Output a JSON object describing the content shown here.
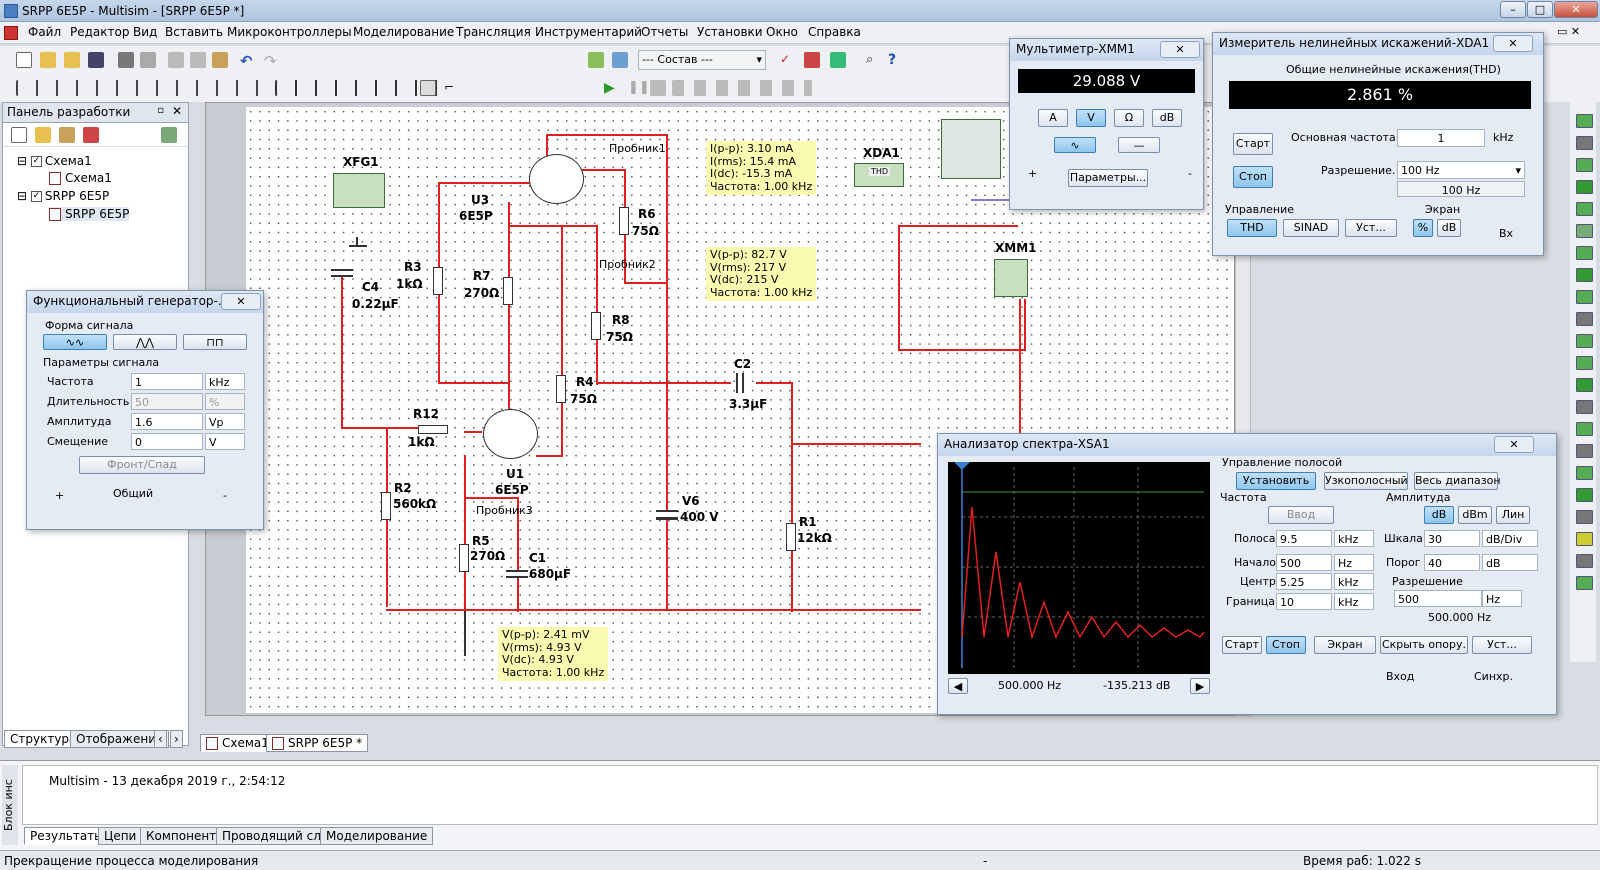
{
  "app": {
    "title": "SRPP  6E5P - Multisim - [SRPP  6E5P *]"
  },
  "menu": [
    "Файл",
    "Редактор",
    "Вид",
    "Вставить",
    "Микроконтроллеры",
    "Моделирование",
    "Трансляция",
    "Инструментарий",
    "Отчеты",
    "Установки",
    "Окно",
    "Справка"
  ],
  "toolbar": {
    "parts_combo": "--- Состав ---"
  },
  "panel": {
    "title": "Панель разработки",
    "tree": [
      "Схема1",
      "Схема1",
      "SRPP  6E5P",
      "SRPP  6E5P"
    ],
    "tabs": [
      "Структура",
      "Отображение"
    ]
  },
  "doc_tabs": [
    "Схема1",
    "SRPP  6E5P *"
  ],
  "schematic": {
    "components": [
      {
        "ref": "XFG1"
      },
      {
        "ref": "C4",
        "value": "0.22µF"
      },
      {
        "ref": "R3",
        "value": "1kΩ"
      },
      {
        "ref": "U3",
        "value": "6E5P"
      },
      {
        "ref": "R7",
        "value": "270Ω"
      },
      {
        "ref": "R6",
        "value": "75Ω"
      },
      {
        "ref": "R8",
        "value": "75Ω"
      },
      {
        "ref": "R4",
        "value": "75Ω"
      },
      {
        "ref": "R12",
        "value": "1kΩ"
      },
      {
        "ref": "U1",
        "value": "6E5P"
      },
      {
        "ref": "R2",
        "value": "560kΩ"
      },
      {
        "ref": "R5",
        "value": "270Ω"
      },
      {
        "ref": "C1",
        "value": "680µF"
      },
      {
        "ref": "V6",
        "value": "400 V"
      },
      {
        "ref": "C2",
        "value": "3.3µF"
      },
      {
        "ref": "R1",
        "value": "12kΩ"
      },
      {
        "ref": "XDA1"
      },
      {
        "ref": "XMM1"
      }
    ],
    "probes": [
      {
        "name": "Пробник1",
        "text": "I(p-p): 3.10 mA\nI(rms): 15.4 mA\nI(dc): -15.3 mA\nЧастота: 1.00 kHz"
      },
      {
        "name": "Пробник2",
        "text": "V(p-p): 82.7 V\nV(rms): 217 V\nV(dc): 215 V\nЧастота: 1.00 kHz"
      },
      {
        "name": "Пробник3",
        "text": "V(p-p): 2.41 mV\nV(rms): 4.93 V\nV(dc): 4.93 V\nЧастота: 1.00 kHz"
      }
    ],
    "xda_label": "THD"
  },
  "multimeter": {
    "title": "Мультиметр-XMM1",
    "value": "29.088 V",
    "modes": [
      "A",
      "V",
      "Ω",
      "dB"
    ],
    "params": "Параметры...",
    "plus": "+",
    "minus": "-"
  },
  "thd": {
    "title": "Измеритель нелинейных искажений-XDA1",
    "subtitle": "Общие нелинейные искажения(THD)",
    "value": "2.861 %",
    "start": "Старт",
    "stop": "Стоп",
    "fund_label": "Основная частота.",
    "fund_value": "1",
    "fund_unit": "kHz",
    "res_label": "Разрешение.",
    "res_value": "100 Hz",
    "res_display": "100 Hz",
    "control_label": "Управление",
    "screen_label": "Экран",
    "btn_thd": "THD",
    "btn_sinad": "SINAD",
    "btn_set": "Уст...",
    "btn_pct": "%",
    "btn_db": "dB",
    "input": "Вх"
  },
  "fgen": {
    "title": "Функциональный генератор-...",
    "wave_label": "Форма сигнала",
    "params_label": "Параметры сигнала",
    "rows": [
      {
        "label": "Частота",
        "value": "1",
        "unit": "kHz"
      },
      {
        "label": "Длительность",
        "value": "50",
        "unit": "%"
      },
      {
        "label": "Амплитуда",
        "value": "1.6",
        "unit": "Vp"
      },
      {
        "label": "Смещение",
        "value": "0",
        "unit": "V"
      }
    ],
    "edge": "Фронт/Спад",
    "plus": "+",
    "common": "Общий",
    "minus": "-"
  },
  "spectrum": {
    "title": "Анализатор спектра-XSA1",
    "band_label": "Управление полосой",
    "btn_set": "Установить",
    "btn_narrow": "Узкополосный",
    "btn_full": "Весь диапазон",
    "freq_label": "Частота",
    "btn_enter": "Ввод",
    "amp_label": "Амплитуда",
    "btn_db": "dB",
    "btn_dbm": "dBm",
    "btn_lin": "Лин",
    "rows": [
      {
        "label": "Полоса",
        "value": "9.5",
        "unit": "kHz"
      },
      {
        "label": "Начало",
        "value": "500",
        "unit": "Hz"
      },
      {
        "label": "Центр",
        "value": "5.25",
        "unit": "kHz"
      },
      {
        "label": "Граница",
        "value": "10",
        "unit": "kHz"
      }
    ],
    "scale_label": "Шкала",
    "scale_value": "30",
    "scale_unit": "dB/Div",
    "thr_label": "Порог",
    "thr_value": "40",
    "thr_unit": "dB",
    "res_label": "Разрешение",
    "res_value": "500",
    "res_unit": "Hz",
    "res_display": "500.000  Hz",
    "start": "Старт",
    "stop": "Стоп",
    "screen": "Экран",
    "hide_ref": "Скрыть опору.",
    "set": "Уст...",
    "cursor_freq": "500.000  Hz",
    "cursor_amp": "-135.213  dB",
    "input": "Вход",
    "sync": "Синхр."
  },
  "results": {
    "side": "Блок инс",
    "text": "Multisim  -  13 декабря 2019 г., 2:54:12",
    "tabs": [
      "Результаты",
      "Цепи",
      "Компоненты",
      "Проводящий слой",
      "Моделирование"
    ]
  },
  "status": {
    "left": "Прекращение процесса моделирования",
    "middle": "-",
    "right": "Время раб: 1.022 s"
  }
}
